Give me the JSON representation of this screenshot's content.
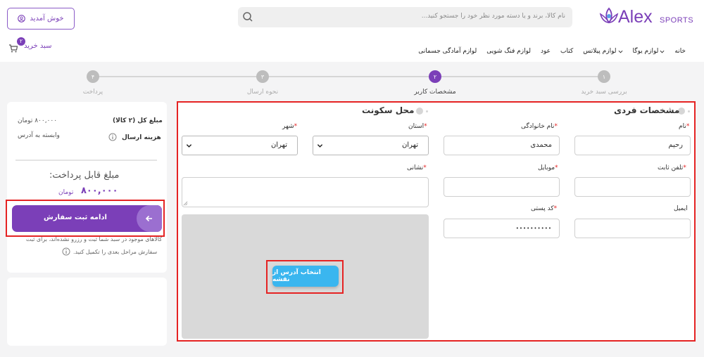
{
  "header": {
    "logo_text": "Alex",
    "logo_sub": "SPORTS",
    "search_placeholder": "نام کالا، برند و یا دسته مورد نظر خود را جستجو کنید...",
    "welcome_label": "خوش آمدید",
    "cart_label": "سبد خرید",
    "cart_count": "۲",
    "nav": [
      "خانه",
      "لوازم یوگا",
      "لوازم پیلاتس",
      "کتاب",
      "عود",
      "لوازم فنگ شویی",
      "لوازم آمادگی جسمانی"
    ]
  },
  "steps": [
    {
      "num": "۱",
      "label": "بررسی سبد خرید",
      "active": false
    },
    {
      "num": "۲",
      "label": "مشخصات کاربر",
      "active": true
    },
    {
      "num": "۳",
      "label": "نحوه ارسال",
      "active": false
    },
    {
      "num": "۴",
      "label": "پرداخت",
      "active": false
    }
  ],
  "summary": {
    "total_label": "مبلغ کل (۲ کالا)",
    "total_value": "۸۰۰,۰۰۰ تومان",
    "shipping_label": "هزینه ارسال",
    "shipping_value": "وابسته به آدرس",
    "payable_label": "مبلغ قابل پرداخت:",
    "payable_amount": "۸۰۰,۰۰۰",
    "payable_currency": "تومان",
    "continue_button": "ادامه ثبت سفارش",
    "note_line1": "کالاهای موجود در سبد شما ثبت و رزرو نشده‌اند، برای ثبت",
    "note_line2": "سفارش مراحل بعدی را تکمیل کنید."
  },
  "personal": {
    "title": "مشخصات فردی",
    "first_name_label": "نام",
    "first_name_value": "رحیم",
    "last_name_label": "نام خانوادگی",
    "last_name_value": "محمدی",
    "phone_label": "تلفن ثابت",
    "phone_value": "",
    "mobile_label": "موبایل",
    "mobile_value": "",
    "email_label": "ایمیل",
    "email_value": "",
    "postal_label": "کد پستی",
    "postal_value": "••••••••••"
  },
  "residence": {
    "title": "محل سکونت",
    "province_label": "استان",
    "province_value": "تهران",
    "city_label": "شهر",
    "city_value": "تهران",
    "address_label": "نشانی",
    "address_value": "",
    "map_button": "انتخاب آدرس از نقشه"
  },
  "colors": {
    "accent": "#7b3fb8",
    "map_button": "#3ab6ef",
    "highlight": "#e52323"
  }
}
